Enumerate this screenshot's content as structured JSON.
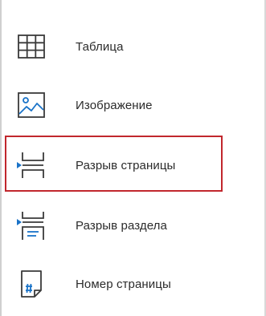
{
  "menu": {
    "items": [
      {
        "label": "Таблица",
        "icon": "table-icon"
      },
      {
        "label": "Изображение",
        "icon": "image-icon"
      },
      {
        "label": "Разрыв страницы",
        "icon": "page-break-icon"
      },
      {
        "label": "Разрыв раздела",
        "icon": "section-break-icon"
      },
      {
        "label": "Номер страницы",
        "icon": "page-number-icon"
      }
    ],
    "highlighted_item": "Разрыв страницы"
  },
  "colors": {
    "icon": "#3a3a3a",
    "accent_blue": "#1a73c8",
    "highlight_border": "#c1272d"
  }
}
